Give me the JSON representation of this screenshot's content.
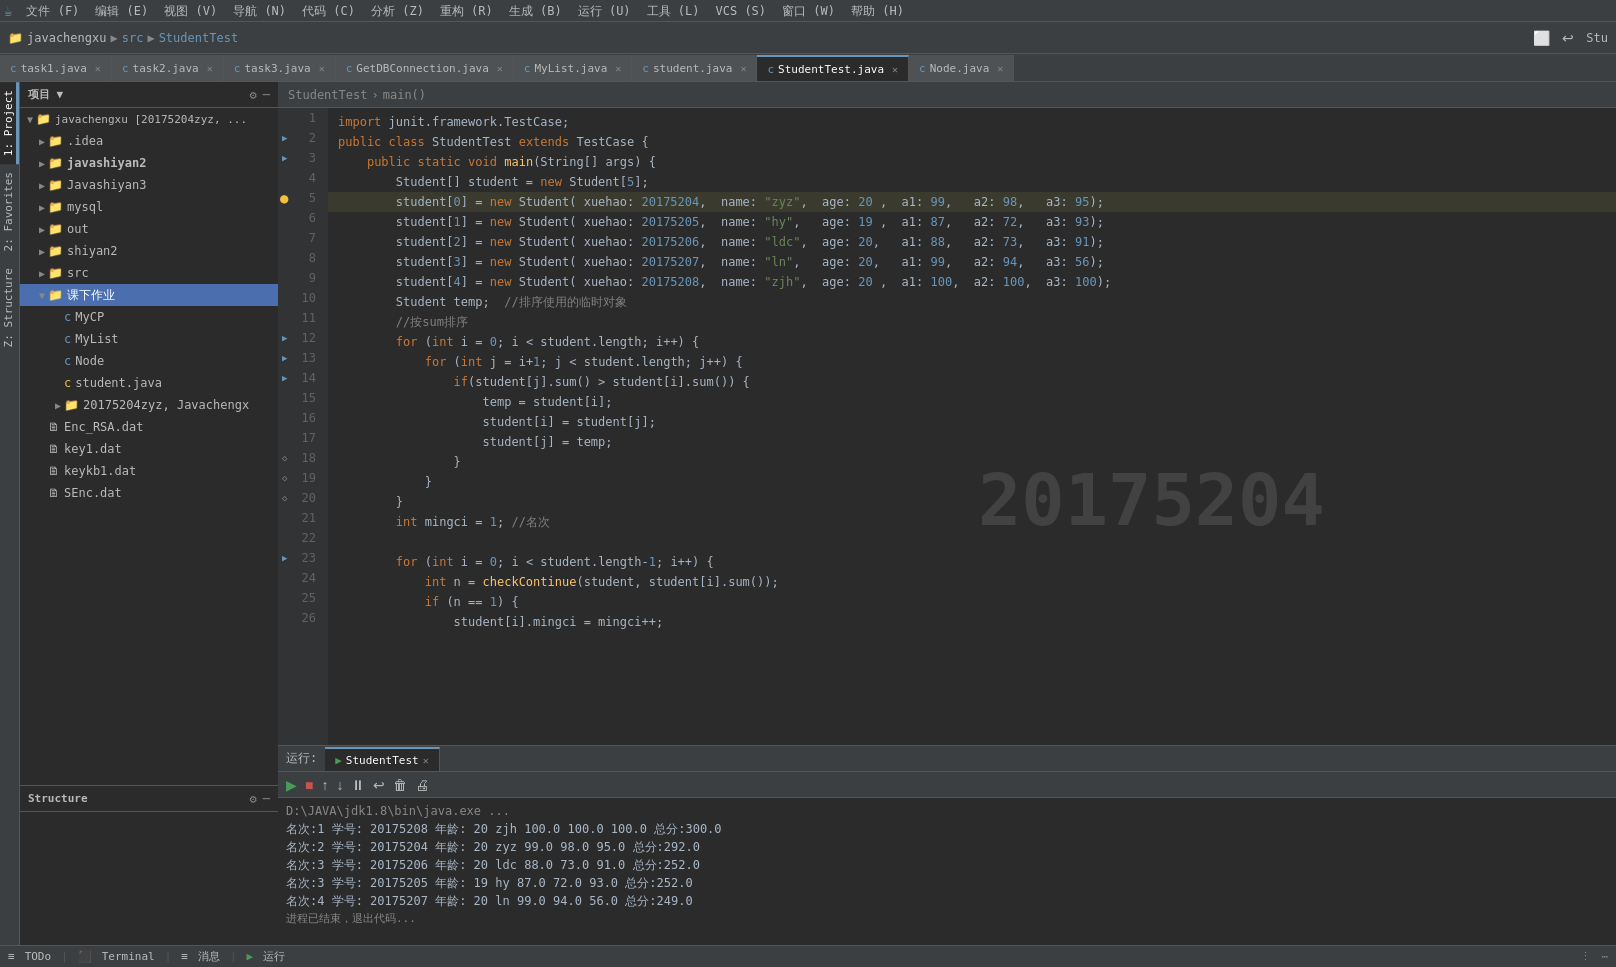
{
  "menuBar": {
    "items": [
      "文件 (F)",
      "编辑 (E)",
      "视图 (V)",
      "导航 (N)",
      "代码 (C)",
      "分析 (Z)",
      "重构 (R)",
      "生成 (B)",
      "运行 (U)",
      "工具 (L)",
      "VCS (S)",
      "窗口 (W)",
      "帮助 (H)"
    ]
  },
  "toolbar": {
    "project": "javachengxu",
    "src": "src",
    "file": "StudentTest"
  },
  "tabs": [
    {
      "label": "task1.java",
      "type": "c",
      "active": false
    },
    {
      "label": "task2.java",
      "type": "c",
      "active": false
    },
    {
      "label": "task3.java",
      "type": "c",
      "active": false
    },
    {
      "label": "GetDBConnection.java",
      "type": "c",
      "active": false
    },
    {
      "label": "MyList.java",
      "type": "c",
      "active": false
    },
    {
      "label": "student.java",
      "type": "c",
      "active": false
    },
    {
      "label": "StudentTest.java",
      "type": "c",
      "active": true
    },
    {
      "label": "Node.java",
      "type": "c",
      "active": false
    }
  ],
  "sidebar": {
    "title": "项目",
    "tree": [
      {
        "indent": 0,
        "arrow": "▼",
        "icon": "folder",
        "label": "javachengxu [20175204zyz, ...",
        "level": 0
      },
      {
        "indent": 1,
        "arrow": "▶",
        "icon": "folder",
        "label": ".idea",
        "level": 1
      },
      {
        "indent": 1,
        "arrow": "▶",
        "icon": "folder",
        "label": "javashiyan2",
        "level": 1,
        "bold": true
      },
      {
        "indent": 1,
        "arrow": "▶",
        "icon": "folder",
        "label": "Javashiyan3",
        "level": 1
      },
      {
        "indent": 1,
        "arrow": "▶",
        "icon": "folder",
        "label": "mysql",
        "level": 1
      },
      {
        "indent": 1,
        "arrow": "▶",
        "icon": "folder",
        "label": "out",
        "level": 1
      },
      {
        "indent": 1,
        "arrow": "▶",
        "icon": "folder",
        "label": "shiyan2",
        "level": 1
      },
      {
        "indent": 1,
        "arrow": "▶",
        "icon": "folder",
        "label": "src",
        "level": 1
      },
      {
        "indent": 1,
        "arrow": "▼",
        "icon": "folder",
        "label": "课下作业",
        "level": 1,
        "selected": true
      },
      {
        "indent": 2,
        "arrow": "",
        "icon": "file-c",
        "label": "MyCP",
        "level": 2
      },
      {
        "indent": 2,
        "arrow": "",
        "icon": "file-c",
        "label": "MyList",
        "level": 2
      },
      {
        "indent": 2,
        "arrow": "",
        "icon": "file-c",
        "label": "Node",
        "level": 2
      },
      {
        "indent": 2,
        "arrow": "",
        "icon": "file-java",
        "label": "student.java",
        "level": 2
      },
      {
        "indent": 2,
        "arrow": "▶",
        "icon": "folder",
        "label": "20175204zyz, Javachengx",
        "level": 2
      },
      {
        "indent": 1,
        "arrow": "",
        "icon": "file",
        "label": "Enc_RSA.dat",
        "level": 1
      },
      {
        "indent": 1,
        "arrow": "",
        "icon": "file",
        "label": "key1.dat",
        "level": 1
      },
      {
        "indent": 1,
        "arrow": "",
        "icon": "file",
        "label": "keykb1.dat",
        "level": 1
      },
      {
        "indent": 1,
        "arrow": "",
        "icon": "file",
        "label": "SEnc.dat",
        "level": 1
      }
    ]
  },
  "structure": {
    "title": "Structure"
  },
  "breadcrumb": {
    "items": [
      "StudentTest",
      "main()"
    ]
  },
  "code": {
    "lines": [
      {
        "n": 1,
        "gutter": "",
        "text": "import junit.framework.TestCase;"
      },
      {
        "n": 2,
        "gutter": "arrow",
        "text": "public class StudentTest extends TestCase {"
      },
      {
        "n": 3,
        "gutter": "arrow",
        "text": "    public static void main(String[] args) {"
      },
      {
        "n": 4,
        "gutter": "",
        "text": "        Student[] student = new Student[5];"
      },
      {
        "n": 5,
        "gutter": "dot",
        "text": "        student[0] = new Student( xuehao: 20175204,  name: \"zyz\",  age: 20 ,  a1: 99,   a2: 98,   a3: 95);"
      },
      {
        "n": 6,
        "gutter": "",
        "text": "        student[1] = new Student( xuehao: 20175205,  name: \"hy\",   age: 19 ,  a1: 87,   a2: 72,   a3: 93);"
      },
      {
        "n": 7,
        "gutter": "",
        "text": "        student[2] = new Student( xuehao: 20175206,  name: \"ldc\",  age: 20,   a1: 88,   a2: 73,   a3: 91);"
      },
      {
        "n": 8,
        "gutter": "",
        "text": "        student[3] = new Student( xuehao: 20175207,  name: \"ln\",   age: 20,   a1: 99,   a2: 94,   a3: 56);"
      },
      {
        "n": 9,
        "gutter": "",
        "text": "        student[4] = new Student( xuehao: 20175208,  name: \"zjh\",  age: 20 ,  a1: 100,  a2: 100,  a3: 100);"
      },
      {
        "n": 10,
        "gutter": "",
        "text": "        Student temp;  //排序使用的临时对象"
      },
      {
        "n": 11,
        "gutter": "",
        "text": "        //按sum排序"
      },
      {
        "n": 12,
        "gutter": "arrow",
        "text": "        for (int i = 0; i < student.length; i++) {"
      },
      {
        "n": 13,
        "gutter": "arrow",
        "text": "            for (int j = i+1; j < student.length; j++) {"
      },
      {
        "n": 14,
        "gutter": "arrow",
        "text": "                if(student[j].sum() > student[i].sum()) {"
      },
      {
        "n": 15,
        "gutter": "",
        "text": "                    temp = student[i];"
      },
      {
        "n": 16,
        "gutter": "",
        "text": "                    student[i] = student[j];"
      },
      {
        "n": 17,
        "gutter": "",
        "text": "                    student[j] = temp;"
      },
      {
        "n": 18,
        "gutter": "diamond",
        "text": "                }"
      },
      {
        "n": 19,
        "gutter": "diamond",
        "text": "            }"
      },
      {
        "n": 20,
        "gutter": "diamond",
        "text": "        }"
      },
      {
        "n": 21,
        "gutter": "",
        "text": "        int mingci = 1; //名次"
      },
      {
        "n": 22,
        "gutter": "",
        "text": ""
      },
      {
        "n": 23,
        "gutter": "arrow",
        "text": "        for (int i = 0; i < student.length-1; i++) {"
      },
      {
        "n": 24,
        "gutter": "",
        "text": "            int n = checkContinue(student, student[i].sum());"
      },
      {
        "n": 25,
        "gutter": "",
        "text": "            if (n == 1) {"
      },
      {
        "n": 26,
        "gutter": "",
        "text": "                student[i].mingci = mingci++;"
      }
    ]
  },
  "bottomPanel": {
    "runLabel": "运行:",
    "tabLabel": "StudentTest",
    "outputLines": [
      "D:\\JAVA\\jdk1.8\\bin\\java.exe ...",
      "名次:1 学号: 20175208 年龄: 20  zjh 100.0 100.0 100.0 总分:300.0",
      "名次:2 学号: 20175204 年龄: 20  zyz 99.0 98.0 95.0 总分:292.0",
      "名次:3 学号: 20175206 年龄: 20  ldc 88.0 73.0 91.0 总分:252.0",
      "名次:3 学号: 20175205 年龄: 19  hy 87.0 72.0 93.0 总分:252.0",
      "名次:4 学号: 20175207 年龄: 20  ln 99.0 94.0 56.0 总分:249.0"
    ]
  },
  "statusBar": {
    "todo": "TODo",
    "terminal": "Terminal",
    "messages": "消息",
    "run": "运行"
  },
  "watermark": "20175204",
  "leftTabs": [
    "1: Project",
    "2: Favorites",
    "Z: Structure"
  ]
}
